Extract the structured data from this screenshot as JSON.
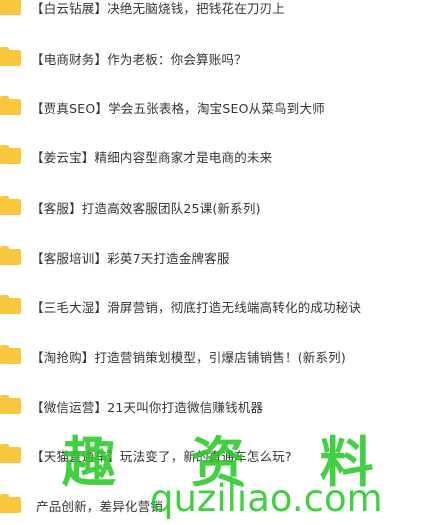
{
  "files": [
    {
      "label": "【白云钻展】决绝无脑烧钱，把钱花在刀刃上"
    },
    {
      "label": "【电商财务】作为老板：你会算账吗？"
    },
    {
      "label": "【贾真SEO】学会五张表格，淘宝SEO从菜鸟到大师"
    },
    {
      "label": "【姜云宝】精细内容型商家才是电商的未来"
    },
    {
      "label": "【客服】打造高效客服团队25课(新系列)"
    },
    {
      "label": "【客服培训】彩英7天打造金牌客服"
    },
    {
      "label": "【三毛大湿】滑屏营销，彻底打造无线端高转化的成功秘诀"
    },
    {
      "label": "【淘抢购】打造营销策划模型，引爆店铺销售！(新系列)"
    },
    {
      "label": "【微信运营】21天叫你打造微信赚钱机器"
    },
    {
      "label": "【天猫直通车】玩法变了，新的直通车怎么玩?"
    },
    {
      "label": "产品创新，差异化营销"
    }
  ],
  "watermark": {
    "text": "趣 资 料",
    "url": "quziliao.com",
    "color": "#28c828"
  },
  "colors": {
    "folder": "#f8c73e",
    "text": "#333333"
  }
}
